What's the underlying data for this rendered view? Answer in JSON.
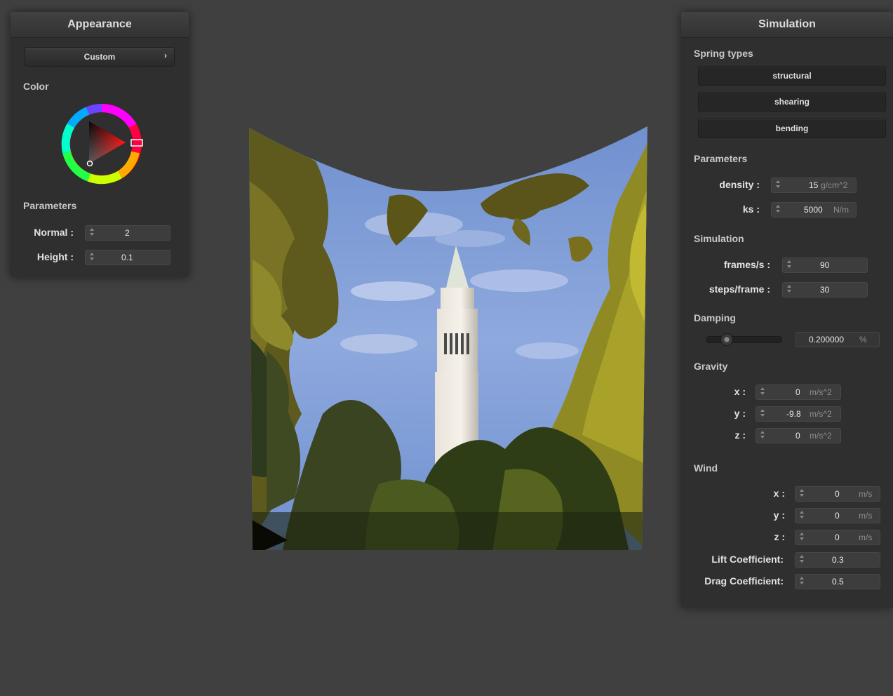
{
  "appearance": {
    "title": "Appearance",
    "preset_label": "Custom",
    "preset_chevron": "›",
    "color_label": "Color",
    "parameters_label": "Parameters",
    "normal_label": "Normal :",
    "normal_value": "2",
    "height_label": "Height :",
    "height_value": "0.1",
    "selected_color": "#ff0000"
  },
  "simulation": {
    "title": "Simulation",
    "spring_types_label": "Spring types",
    "spring_buttons": [
      "structural",
      "shearing",
      "bending"
    ],
    "parameters_label": "Parameters",
    "density_label": "density :",
    "density_value": "15",
    "density_unit": "g/cm^2",
    "ks_label": "ks :",
    "ks_value": "5000",
    "ks_unit": "N/m",
    "sim_label": "Simulation",
    "fps_label": "frames/s :",
    "fps_value": "90",
    "steps_label": "steps/frame :",
    "steps_value": "30",
    "damping_label": "Damping",
    "damping_value": "0.200000",
    "damping_unit": "%",
    "damping_level": 0.2,
    "gravity_label": "Gravity",
    "gravity": [
      {
        "label": "x :",
        "value": "0",
        "unit": "m/s^2"
      },
      {
        "label": "y :",
        "value": "-9.8",
        "unit": "m/s^2"
      },
      {
        "label": "z :",
        "value": "0",
        "unit": "m/s^2"
      }
    ],
    "wind_label": "Wind",
    "wind": [
      {
        "label": "x :",
        "value": "0",
        "unit": "m/s"
      },
      {
        "label": "y :",
        "value": "0",
        "unit": "m/s"
      },
      {
        "label": "z :",
        "value": "0",
        "unit": "m/s"
      }
    ],
    "lift_label": "Lift Coefficient:",
    "lift_value": "0.3",
    "drag_label": "Drag Coefficient:",
    "drag_value": "0.5"
  },
  "viewport": {
    "background": "#404040"
  }
}
